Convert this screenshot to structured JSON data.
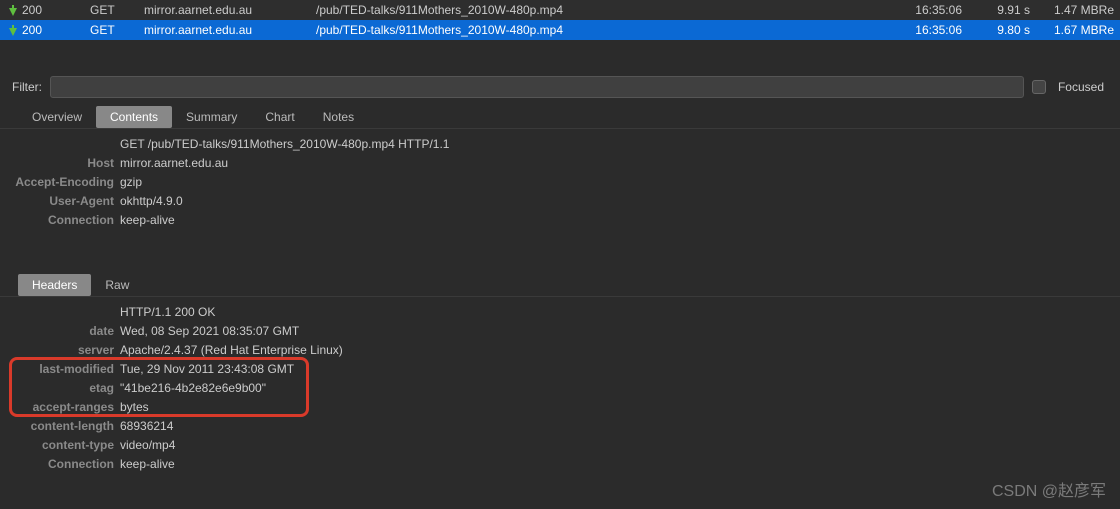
{
  "requests": [
    {
      "status": "200",
      "method": "GET",
      "host": "mirror.aarnet.edu.au",
      "path": "/pub/TED-talks/911Mothers_2010W-480p.mp4",
      "time": "16:35:06",
      "duration": "9.91 s",
      "size": "1.47 MBRe"
    },
    {
      "status": "200",
      "method": "GET",
      "host": "mirror.aarnet.edu.au",
      "path": "/pub/TED-talks/911Mothers_2010W-480p.mp4",
      "time": "16:35:06",
      "duration": "9.80 s",
      "size": "1.67 MBRe"
    }
  ],
  "filter": {
    "label": "Filter:",
    "value": "",
    "placeholder": "",
    "focused": "Focused"
  },
  "tabs": {
    "overview": "Overview",
    "contents": "Contents",
    "summary": "Summary",
    "chart": "Chart",
    "notes": "Notes"
  },
  "requestLine": "GET /pub/TED-talks/911Mothers_2010W-480p.mp4 HTTP/1.1",
  "reqHeaders": {
    "Host": "mirror.aarnet.edu.au",
    "Accept-Encoding": "gzip",
    "User-Agent": "okhttp/4.9.0",
    "Connection": "keep-alive"
  },
  "subTabs": {
    "headers": "Headers",
    "raw": "Raw"
  },
  "statusLine": "HTTP/1.1 200 OK",
  "respHeaders": {
    "date": "Wed, 08 Sep 2021 08:35:07 GMT",
    "server": "Apache/2.4.37 (Red Hat Enterprise Linux)",
    "last-modified": "Tue, 29 Nov 2011 23:43:08 GMT",
    "etag": "\"41be216-4b2e82e6e9b00\"",
    "accept-ranges": "bytes",
    "content-length": "68936214",
    "content-type": "video/mp4",
    "Connection": "keep-alive"
  },
  "labels": {
    "Host": "Host",
    "AcceptEncoding": "Accept-Encoding",
    "UserAgent": "User-Agent",
    "ConnectionReq": "Connection",
    "date": "date",
    "server": "server",
    "lastModified": "last-modified",
    "etag": "etag",
    "acceptRanges": "accept-ranges",
    "contentLength": "content-length",
    "contentType": "content-type",
    "ConnectionResp": "Connection"
  },
  "watermark": "CSDN @赵彦军"
}
